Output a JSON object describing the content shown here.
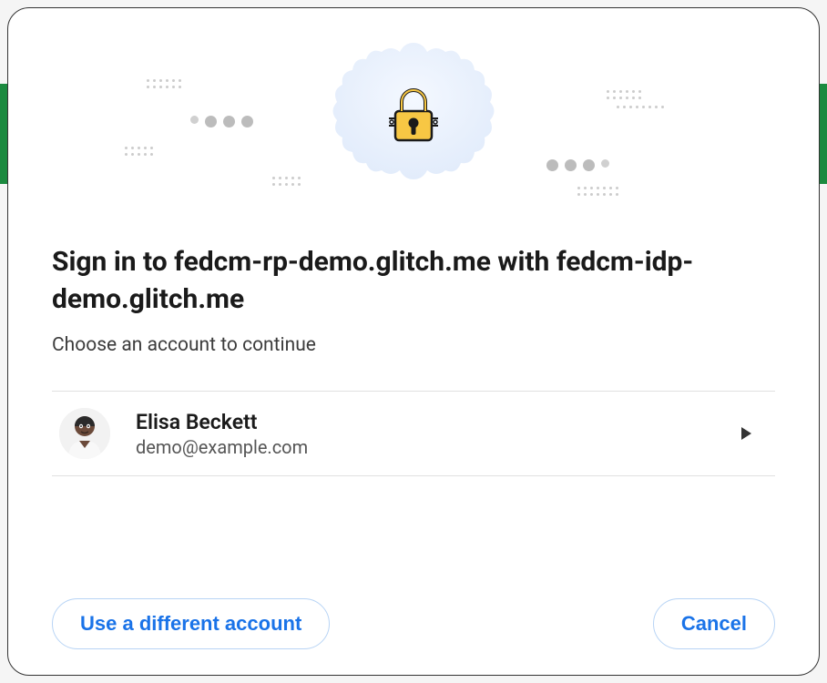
{
  "dialog": {
    "title": "Sign in to fedcm-rp-demo.glitch.me with fedcm-idp-demo.glitch.me",
    "subtitle": "Choose an account to continue"
  },
  "accounts": [
    {
      "name": "Elisa Beckett",
      "email": "demo@example.com"
    }
  ],
  "buttons": {
    "use_different": "Use a different account",
    "cancel": "Cancel"
  },
  "icons": {
    "lock": "lock-icon",
    "chevron_right": "chevron-right-icon"
  }
}
